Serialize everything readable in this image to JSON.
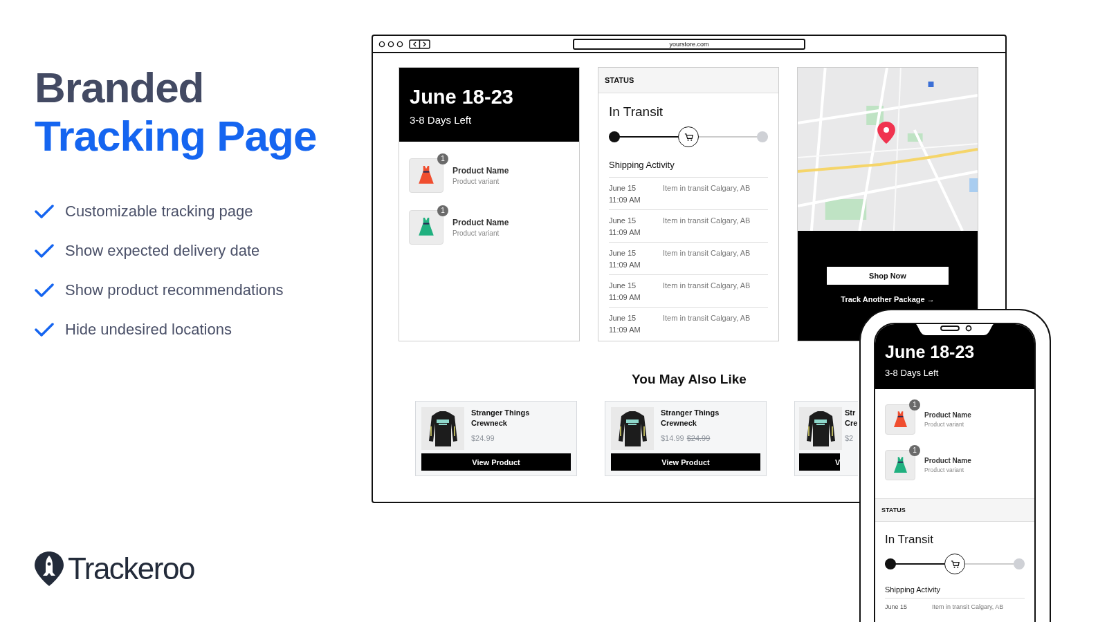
{
  "headline": {
    "line_1": "Branded",
    "line_2": "Tracking Page"
  },
  "features": [
    "Customizable tracking page",
    "Show expected delivery date",
    "Show product recommendations",
    "Hide undesired locations"
  ],
  "logo": {
    "name": "Trackeroo"
  },
  "browser": {
    "url": "yourstore.com",
    "delivery_card": {
      "date_range": "June 18-23",
      "days_left": "3-8 Days Left",
      "products": [
        {
          "name": "Product Name",
          "variant": "Product variant",
          "quantity": "1",
          "color": "#f04e2f"
        },
        {
          "name": "Product Name",
          "variant": "Product variant",
          "quantity": "1",
          "color": "#20b07f"
        }
      ]
    },
    "status_card": {
      "header": "STATUS",
      "status": "In Transit",
      "level": 0.5,
      "activity_title": "Shipping Activity",
      "activity": [
        {
          "date": "June 15",
          "time": "11:09 AM",
          "description": "Item in transit Calgary, AB"
        },
        {
          "date": "June 15",
          "time": "11:09 AM",
          "description": "Item in transit Calgary, AB"
        },
        {
          "date": "June 15",
          "time": "11:09 AM",
          "description": "Item in transit Calgary, AB"
        },
        {
          "date": "June 15",
          "time": "11:09 AM",
          "description": "Item in transit Calgary, AB"
        },
        {
          "date": "June 15",
          "time": "11:09 AM",
          "description": "Item in transit Calgary, AB"
        }
      ]
    },
    "map_card": {
      "kind": "picture",
      "shop_button": "Shop Now",
      "track_link": "Track Another Package →"
    },
    "recommendations": {
      "title": "You May Also Like",
      "products": [
        {
          "title_lines": [
            "Stranger Things",
            "Crewneck"
          ],
          "price": "$24.99",
          "button": "View Product",
          "cut": false
        },
        {
          "title_lines": [
            "Stranger Things",
            "Crewneck"
          ],
          "price": "$14.99",
          "compare_price": "$24.99",
          "button": "View Product",
          "cut": false
        },
        {
          "title_lines": [
            "Str",
            "Cre"
          ],
          "price": "$2",
          "button": "V",
          "cut": true
        }
      ]
    }
  },
  "phone": {
    "date_range": "June 18-23",
    "days_left": "3-8 Days Left",
    "products": [
      {
        "name": "Product Name",
        "variant": "Product variant",
        "quantity": "1",
        "color": "#f04e2f"
      },
      {
        "name": "Product Name",
        "variant": "Product variant",
        "quantity": "1",
        "color": "#20b07f"
      }
    ],
    "status_header": "STATUS",
    "status": "In Transit",
    "level": 0.5,
    "activity_title": "Shipping Activity",
    "activity": [
      {
        "date": "June 15",
        "description": "Item in transit Calgary, AB"
      }
    ]
  }
}
